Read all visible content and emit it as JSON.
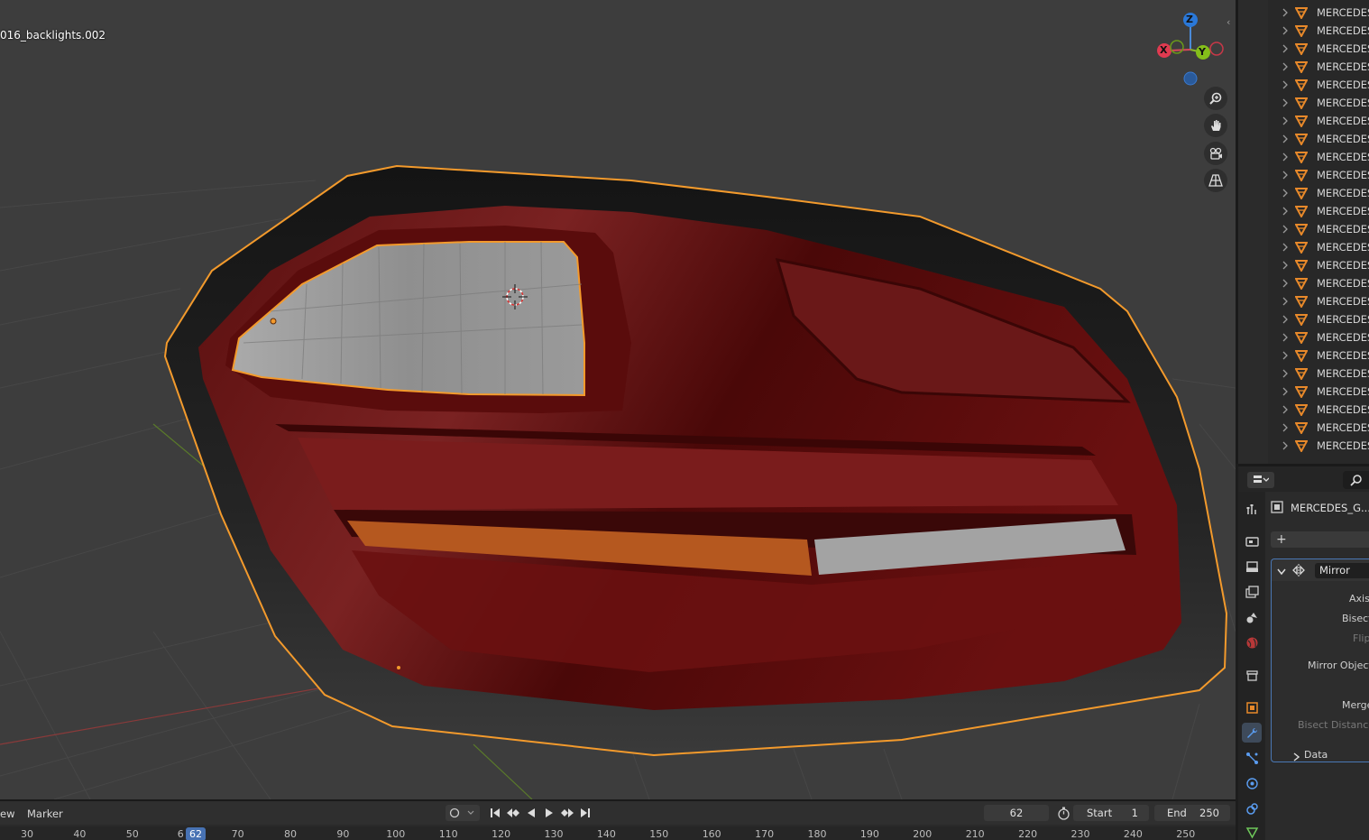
{
  "viewport": {
    "object_name": "016_backlights.002",
    "gizmo": {
      "z": "Z",
      "y": "Y",
      "x": "X"
    }
  },
  "outliner": {
    "items": [
      "MERCEDES",
      "MERCEDES",
      "MERCEDES",
      "MERCEDES",
      "MERCEDES",
      "MERCEDES",
      "MERCEDES",
      "MERCEDES",
      "MERCEDES",
      "MERCEDES",
      "MERCEDES",
      "MERCEDES",
      "MERCEDES",
      "MERCEDES",
      "MERCEDES",
      "MERCEDES",
      "MERCEDES",
      "MERCEDES",
      "MERCEDES",
      "MERCEDES",
      "MERCEDES",
      "MERCEDES",
      "MERCEDES",
      "MERCEDES",
      "MERCEDES"
    ]
  },
  "properties": {
    "object_name": "MERCEDES_G...",
    "add_modifier": "+",
    "modifier": {
      "name": "Mirror",
      "axis_label": "Axis",
      "bisect_label": "Bisect",
      "flip_label": "Flip",
      "mirror_object_label": "Mirror Object",
      "merge_label": "Merge",
      "bisect_distance_label": "Bisect Distance",
      "data_label": "Data"
    }
  },
  "timeline": {
    "menu": {
      "view": "ew",
      "marker": "Marker"
    },
    "current_frame": "62",
    "start_label": "Start",
    "start_value": "1",
    "end_label": "End",
    "end_value": "250",
    "ruler_ticks": [
      "30",
      "40",
      "50",
      "6",
      "70",
      "80",
      "90",
      "100",
      "110",
      "120",
      "130",
      "140",
      "150",
      "160",
      "170",
      "180",
      "190",
      "200",
      "210",
      "220",
      "230",
      "240",
      "250"
    ],
    "current_badge": "62"
  },
  "colors": {
    "selection": "#f39a2c",
    "accent": "#4772b3",
    "mesh_red": "#6e1414"
  }
}
